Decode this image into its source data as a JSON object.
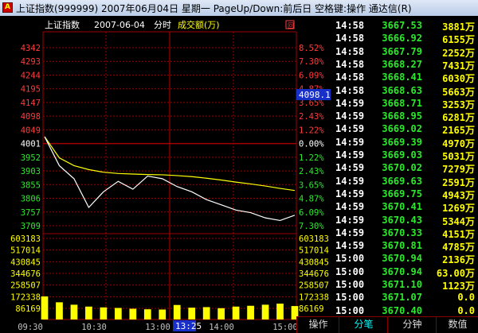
{
  "window": {
    "title": "上证指数(999999) 2007年06月04日 星期一 PageUp/Down:前后日 空格键:操作 通达信(R)",
    "icon_label": "A"
  },
  "header": {
    "name": "上证指数",
    "date": "2007-06-04",
    "view": "分时",
    "volume_label": "成交额(万)",
    "corner_icon": "回"
  },
  "price_axis": {
    "left": [
      "4342",
      "4293",
      "4244",
      "4195",
      "4147",
      "4098",
      "4049",
      "4001",
      "3952",
      "3903",
      "3855",
      "3806",
      "3757",
      "3709"
    ],
    "right": [
      "8.52%",
      "7.30%",
      "6.09%",
      "4.87%",
      "3.65%",
      "2.43%",
      "1.22%",
      "0.00%",
      "1.22%",
      "2.43%",
      "3.65%",
      "4.87%",
      "6.09%",
      "7.30%"
    ],
    "cursor_value": "4098.15"
  },
  "volume_axis": {
    "left": [
      "603183",
      "517014",
      "430845",
      "344676",
      "258507",
      "172338",
      "86169"
    ],
    "right": [
      "603183",
      "517014",
      "430845",
      "344676",
      "258507",
      "172338",
      "86169"
    ]
  },
  "time_axis": {
    "labels": [
      "09:30",
      "10:30",
      "13:00",
      "14:00",
      "15:00"
    ],
    "cursor": "13:25"
  },
  "colors": {
    "up": "#ff3c3c",
    "down": "#2ee82e",
    "price_line": "#ffffff",
    "avg_line": "#ffff00",
    "grid": "#a00000",
    "volume": "#ffff00"
  },
  "chart_data": {
    "type": "line",
    "open": 4001,
    "ylim": [
      3660,
      4342
    ],
    "x": [
      "09:30",
      "09:45",
      "10:00",
      "10:15",
      "10:30",
      "10:45",
      "11:00",
      "11:15",
      "11:30",
      "13:00",
      "13:15",
      "13:30",
      "13:45",
      "14:00",
      "14:15",
      "14:30",
      "14:45",
      "15:00"
    ],
    "series": [
      {
        "values": [
          4001,
          3890,
          3840,
          3730,
          3790,
          3830,
          3800,
          3850,
          3840,
          3810,
          3790,
          3760,
          3740,
          3720,
          3710,
          3690,
          3680,
          3700
        ]
      },
      {
        "values": [
          4001,
          3920,
          3890,
          3875,
          3865,
          3860,
          3858,
          3856,
          3855,
          3852,
          3848,
          3842,
          3835,
          3827,
          3820,
          3812,
          3803,
          3795
        ]
      }
    ],
    "volume": {
      "ylim": [
        0,
        603183
      ],
      "values": [
        172000,
        128000,
        110000,
        96000,
        90000,
        86000,
        80000,
        76000,
        74000,
        108000,
        88000,
        92000,
        84000,
        96000,
        102000,
        110000,
        118000,
        100000
      ]
    }
  },
  "ticks": [
    {
      "time": "14:58",
      "price": "3667.53",
      "vol": "3881万"
    },
    {
      "time": "14:58",
      "price": "3666.92",
      "vol": "6155万"
    },
    {
      "time": "14:58",
      "price": "3667.79",
      "vol": "2252万"
    },
    {
      "time": "14:58",
      "price": "3668.27",
      "vol": "7431万"
    },
    {
      "time": "14:58",
      "price": "3668.41",
      "vol": "6030万"
    },
    {
      "time": "14:58",
      "price": "3668.63",
      "vol": "5663万"
    },
    {
      "time": "14:59",
      "price": "3668.71",
      "vol": "3253万"
    },
    {
      "time": "14:59",
      "price": "3668.95",
      "vol": "6281万"
    },
    {
      "time": "14:59",
      "price": "3669.02",
      "vol": "2165万"
    },
    {
      "time": "14:59",
      "price": "3669.39",
      "vol": "4970万"
    },
    {
      "time": "14:59",
      "price": "3669.03",
      "vol": "5031万"
    },
    {
      "time": "14:59",
      "price": "3670.02",
      "vol": "7279万"
    },
    {
      "time": "14:59",
      "price": "3669.63",
      "vol": "2591万"
    },
    {
      "time": "14:59",
      "price": "3669.75",
      "vol": "4943万"
    },
    {
      "time": "14:59",
      "price": "3670.41",
      "vol": "1269万"
    },
    {
      "time": "14:59",
      "price": "3670.43",
      "vol": "5344万"
    },
    {
      "time": "14:59",
      "price": "3670.33",
      "vol": "4151万"
    },
    {
      "time": "14:59",
      "price": "3670.81",
      "vol": "4785万"
    },
    {
      "time": "15:00",
      "price": "3670.94",
      "vol": "2136万"
    },
    {
      "time": "15:00",
      "price": "3670.94",
      "vol": "63.00万"
    },
    {
      "time": "15:00",
      "price": "3671.10",
      "vol": "1123万"
    },
    {
      "time": "15:00",
      "price": "3671.07",
      "vol": "0.0"
    },
    {
      "time": "15:00",
      "price": "3670.40",
      "vol": "0.0"
    }
  ],
  "tabs": [
    "操作",
    "分笔",
    "分钟",
    "数值"
  ],
  "active_tab": 1
}
